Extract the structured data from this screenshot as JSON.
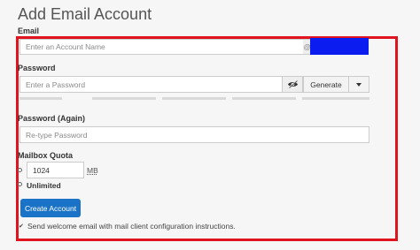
{
  "page": {
    "title": "Add Email Account"
  },
  "email": {
    "heading": "Email",
    "placeholder": "Enter an Account Name",
    "domain_symbol": "@"
  },
  "password": {
    "label": "Password",
    "placeholder": "Enter a Password",
    "generate_label": "Generate",
    "strength_segments": 5
  },
  "password_again": {
    "label": "Password (Again)",
    "placeholder": "Re-type Password"
  },
  "quota": {
    "label": "Mailbox Quota",
    "value": "1024",
    "unit": "MB",
    "unlimited_label": "Unlimited"
  },
  "actions": {
    "create_label": "Create Account",
    "welcome_text": "Send welcome email with mail client configuration instructions.",
    "welcome_checked": true
  },
  "colors": {
    "highlight": "#e0141e",
    "primary_button": "#1a73c6",
    "redacted_domain": "#0b1cf0"
  },
  "icons": {
    "visibility_toggle": "eye-slash-icon",
    "dropdown": "caret-down-icon",
    "check": "check-icon"
  }
}
